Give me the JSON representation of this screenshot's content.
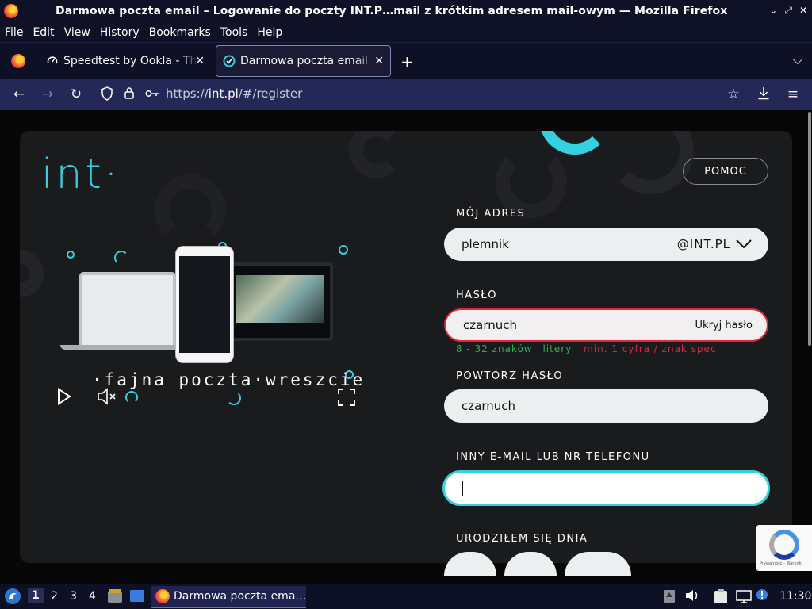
{
  "window": {
    "title": "Darmowa poczta email – Logowanie do poczty INT.P…mail z krótkim adresem mail-owym — Mozilla Firefox",
    "minimize": "⌄",
    "maximize": "⤢",
    "close": "✕"
  },
  "menu": [
    "File",
    "Edit",
    "View",
    "History",
    "Bookmarks",
    "Tools",
    "Help"
  ],
  "tabs": [
    {
      "label": "Speedtest by Ookla - The Global Broadband Speed Test",
      "active": false
    },
    {
      "label": "Darmowa poczta email – Logowanie do poczty INT.PL",
      "active": true
    }
  ],
  "nav": {
    "url_prefix": "https://",
    "url_host": "int.pl",
    "url_path": "/#/register"
  },
  "page": {
    "logo": "int·",
    "help_button": "POMOC",
    "tagline": "·fajna poczta·wreszcie",
    "address_label": "MÓJ ADRES",
    "address_value": "plemnik",
    "address_domain": "@INT.PL",
    "password_label": "HASŁO",
    "password_value": "czarnuch",
    "password_toggle": "Ukryj hasło",
    "hint_length": "8 - 32 znaków",
    "hint_letters": "litery",
    "hint_digit": "min. 1 cyfra / znak spec.",
    "hint_colors": {
      "ok": "#29b34a",
      "bad": "#e4273a"
    },
    "repeat_label": "POWTÓRZ HASŁO",
    "repeat_value": "czarnuch",
    "other_label": "INNY E-MAIL LUB NR TELEFONU",
    "other_value": "",
    "dob_label": "URODZIŁEM SIĘ DNIA",
    "accent_color": "#35d0e0",
    "recaptcha_text": "Prywatność - Warunki"
  },
  "taskbar": {
    "workspaces": [
      "1",
      "2",
      "3",
      "4"
    ],
    "active_task": "Darmowa poczta ema…",
    "clock": "11:30"
  }
}
